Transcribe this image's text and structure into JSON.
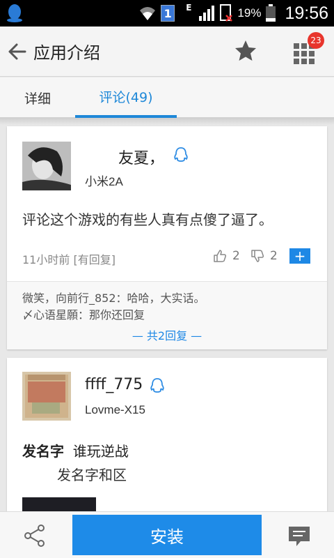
{
  "status_bar": {
    "notification_badge": "1",
    "network_type": "E",
    "battery_percent": "19%",
    "time": "19:56"
  },
  "header": {
    "title": "应用介绍",
    "apps_badge_count": "23"
  },
  "tabs": [
    {
      "label": "详细"
    },
    {
      "label": "评论(49)"
    }
  ],
  "comments": [
    {
      "user": "友夏，",
      "device": "小米2A",
      "text": "评论这个游戏的有些人真有点傻了逼了。",
      "time": "11小时前 [有回复]",
      "likes": "2",
      "dislikes": "2",
      "plus_label": "+",
      "replies": [
        "微笑，向前行_852：哈哈，大实话。",
        "〆心语星願：那你还回复"
      ],
      "more_replies": "— 共2回复 —"
    },
    {
      "user": "ffff_775",
      "device": "Lovme-X15",
      "title_bold": "发名字",
      "title_rest": "谁玩逆战",
      "text_line2": "发名字和区"
    }
  ],
  "bottom_bar": {
    "install_label": "安装"
  },
  "colors": {
    "accent": "#1e88e5",
    "badge": "#e8352c"
  }
}
